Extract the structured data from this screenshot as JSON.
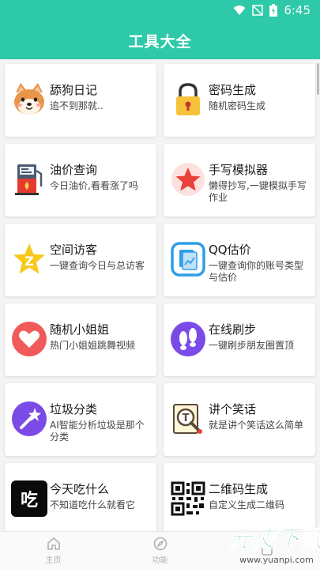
{
  "status_bar": {
    "time": "6:45"
  },
  "app_bar": {
    "title": "工具大全"
  },
  "tools": [
    {
      "name": "舔狗日记",
      "desc": "追不到那就.."
    },
    {
      "name": "密码生成",
      "desc": "随机密码生成"
    },
    {
      "name": "油价查询",
      "desc": "今日油价,看看涨了吗"
    },
    {
      "name": "手写模拟器",
      "desc": "懒得抄写,一键模拟手写作业"
    },
    {
      "name": "空间访客",
      "desc": "一键查询今日与总访客"
    },
    {
      "name": "QQ估价",
      "desc": "一键查询你的账号类型与估价"
    },
    {
      "name": "随机小姐姐",
      "desc": "热门小姐姐跳舞视频"
    },
    {
      "name": "在线刷步",
      "desc": "一键刷步朋友圈置顶"
    },
    {
      "name": "垃圾分类",
      "desc": "AI智能分析垃圾是那个分类"
    },
    {
      "name": "讲个笑话",
      "desc": "就是讲个笑话这么简单"
    },
    {
      "name": "今天吃什么",
      "desc": "不知道吃什么就看它"
    },
    {
      "name": "二维码生成",
      "desc": "自定义生成二维码"
    }
  ],
  "icons": {
    "eat_char": "吃",
    "joke_char": "T"
  },
  "bottom_nav": [
    {
      "label": "主页",
      "icon": "home-icon"
    },
    {
      "label": "功能",
      "icon": "compass-icon"
    },
    {
      "label": "",
      "icon": ""
    }
  ],
  "watermark": {
    "text": "元皮下载",
    "url": "www.yuanpi.com"
  },
  "colors": {
    "accent": "#2ec9a8"
  }
}
